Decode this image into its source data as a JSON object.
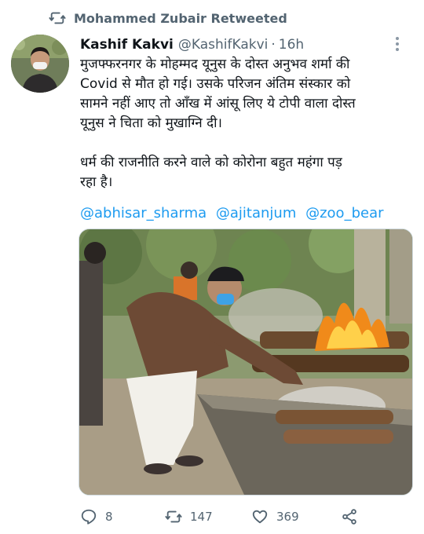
{
  "retweet": {
    "label": "Mohammed Zubair Retweeted"
  },
  "tweet": {
    "author_name": "Kashif Kakvi",
    "author_handle": "@KashifKakvi",
    "separator": "·",
    "time": "16h",
    "text_paragraph_1": "मुजफ्फरनगर के मोहम्मद यूनुस के दोस्त अनुभव शर्मा की\nCovid से मौत हो गई। उसके परिजन अंतिम संस्कार को\nसामने नहीं आए तो आँख में आंसू लिए ये टोपी वाला दोस्त\nयूनुस ने चिता को मुखाग्नि दी।",
    "text_paragraph_2": "धर्म की राजनीति करने वाले को कोरोना बहुत महंगा पड़\nरहा है।",
    "mentions": [
      "@abhisar_sharma",
      "@ajitanjum",
      "@zoo_bear"
    ]
  },
  "actions": {
    "replies": "8",
    "retweets": "147",
    "likes": "369"
  },
  "icons": {
    "retweet_header": "retweet-icon",
    "more": "more-options-icon",
    "reply": "reply-icon",
    "retweet": "retweet-icon",
    "like": "heart-icon",
    "share": "share-icon"
  },
  "colors": {
    "link": "#1d9bf0",
    "secondary_text": "#536471",
    "primary_text": "#0f1419"
  }
}
